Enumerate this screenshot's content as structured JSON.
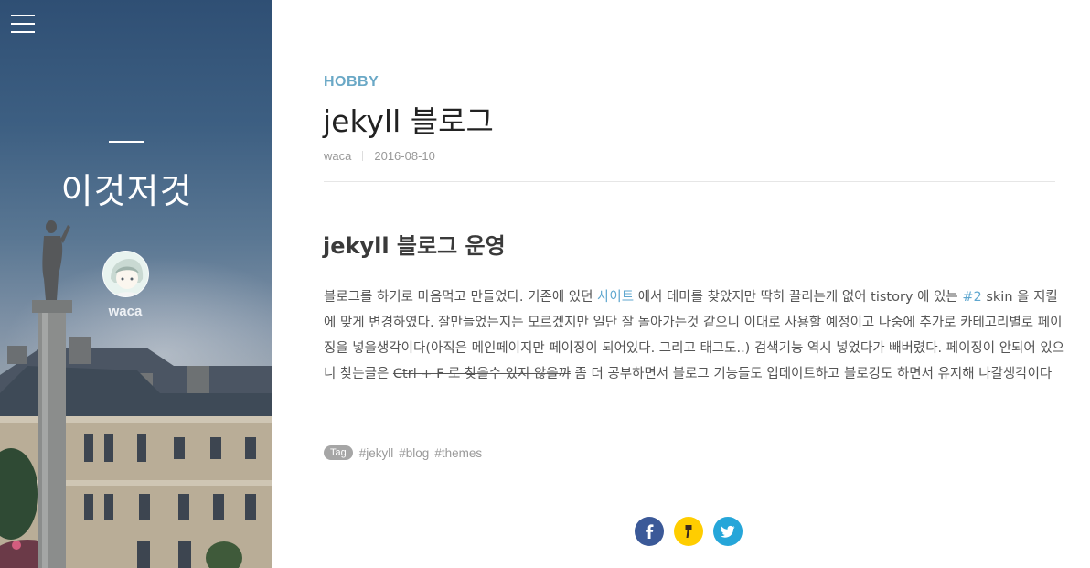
{
  "colors": {
    "accent": "#6aa8c6",
    "link": "#5fa7cf",
    "facebook": "#3b5998",
    "kakaostory": "#ffcd00",
    "twitter": "#26a6d9"
  },
  "sidebar": {
    "menu_icon": "hamburger-menu-icon",
    "blog_title": "이것저것",
    "author": "waca"
  },
  "post": {
    "category": "HOBBY",
    "title": "jekyll 블로그",
    "meta": {
      "author": "waca",
      "date": "2016-08-10"
    },
    "heading": "jekyll 블로그 운영",
    "body": {
      "t1": "블로그를 하기로 마음먹고 만들었다. 기존에 있던 ",
      "link1": "사이트",
      "t2": " 에서 테마를 찾았지만 딱히 끌리는게 없어 tistory 에 있는 ",
      "link2": "#2",
      "t3": " skin 을 지킬에 맞게 변경하였다. 잘만들었는지는 모르겠지만 일단 잘 돌아가는것 같으니 이대로 사용할 예정이고 나중에 추가로 카테고리별로 페이징을 넣을생각이다(아직은 메인페이지만 페이징이 되어있다. 그리고 태그도..) 검색기능 역시 넣었다가 빼버렸다. 페이징이 안되어 있으니 찾는글은 ",
      "strike": "Ctrl + F 로 찾을수 있지 않을까",
      "t4": " 좀 더 공부하면서 블로그 기능들도 업데이트하고 블로깅도 하면서 유지해 나갈생각이다"
    },
    "tags": {
      "label": "Tag",
      "items": [
        "#jekyll",
        "#blog",
        "#themes"
      ]
    }
  },
  "share": {
    "icons": [
      "facebook-icon",
      "kakaostory-icon",
      "twitter-icon"
    ]
  }
}
